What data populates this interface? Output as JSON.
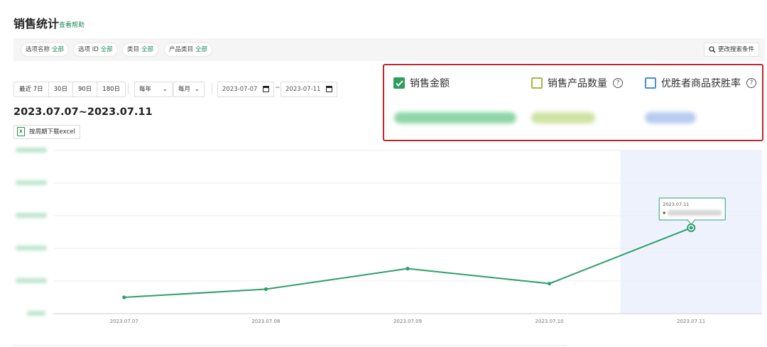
{
  "header": {
    "title": "销售统计",
    "help_link": "查看帮助"
  },
  "filters": {
    "chips": [
      {
        "label": "选项名称",
        "value": "全部"
      },
      {
        "label": "选项 ID",
        "value": "全部"
      },
      {
        "label": "类目",
        "value": "全部"
      },
      {
        "label": "产品类目",
        "value": "全部"
      }
    ],
    "search_more": "更改搜索条件"
  },
  "toolbar": {
    "periods": [
      "最近 7日",
      "30日",
      "90日",
      "180日"
    ],
    "year_select": "每年",
    "month_select": "每月",
    "date_start": "2023-07-07",
    "date_sep": "~",
    "date_end": "2023-07-11"
  },
  "range_label": "2023.07.07~2023.07.11",
  "excel_button": "按周期下载excel",
  "metrics": [
    {
      "label": "销售金额",
      "checked": true,
      "color": "#2e9e5e",
      "has_help": false
    },
    {
      "label": "销售产品数量",
      "checked": false,
      "color": "#a5b748",
      "has_help": true
    },
    {
      "label": "优胜者商品获胜率",
      "checked": false,
      "color": "#4a8fd6",
      "has_help": true
    }
  ],
  "chart_data": {
    "type": "line",
    "x": [
      "2023.07.07",
      "2023.07.08",
      "2023.07.09",
      "2023.07.10",
      "2023.07.11"
    ],
    "series": [
      {
        "values": [
          0.5,
          0.75,
          1.38,
          0.92,
          2.63
        ]
      }
    ],
    "ylim": [
      0,
      5
    ],
    "y_tick_count": 6,
    "grid": true,
    "highlight_category": "2023.07.11",
    "line_color": "#2e9e6b",
    "tooltip": {
      "date": "2023.07.11"
    }
  }
}
